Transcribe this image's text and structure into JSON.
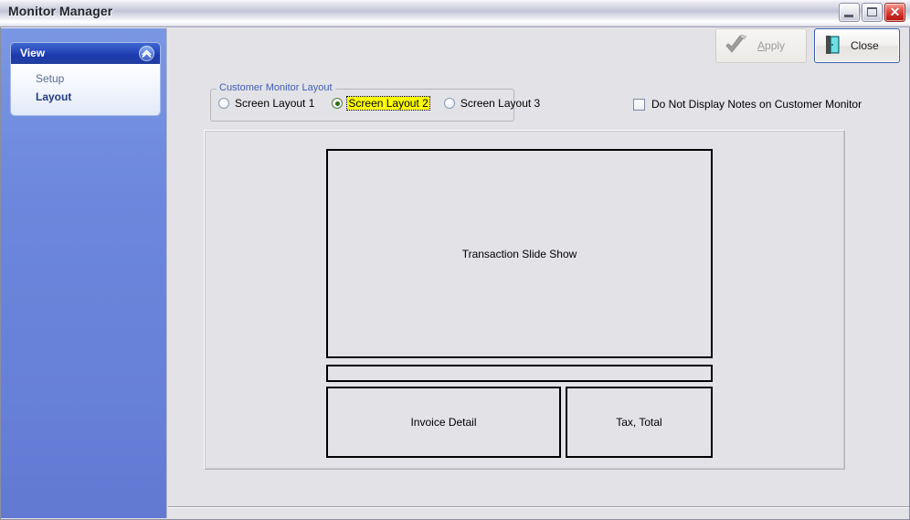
{
  "window": {
    "title": "Monitor Manager",
    "controls": [
      {
        "name": "minimize",
        "glyph": "minimize-icon"
      },
      {
        "name": "maximize",
        "glyph": "maximize-icon"
      },
      {
        "name": "close",
        "glyph": "close-icon",
        "label": "✕"
      }
    ],
    "titlebar_color": "#c2c4d6"
  },
  "sidebar": {
    "background_color": "#6b85db",
    "group": {
      "title": "View",
      "collapse_icon": "chevron-up-icon",
      "items": [
        {
          "label": "Setup",
          "active": false
        },
        {
          "label": "Layout",
          "active": true
        }
      ]
    }
  },
  "toolbar": {
    "apply": {
      "label": "Apply",
      "accel": "A",
      "enabled": false,
      "icon": "checkmark-icon"
    },
    "close": {
      "label": "Close",
      "enabled": true,
      "icon": "exit-door-icon"
    }
  },
  "groupbox": {
    "legend": "Customer Monitor Layout",
    "legend_color": "#3f5fb5",
    "options": [
      {
        "label": "Screen Layout 1",
        "checked": false,
        "focused": false
      },
      {
        "label": "Screen Layout 2",
        "checked": true,
        "focused": true
      },
      {
        "label": "Screen Layout 3",
        "checked": false,
        "focused": false
      }
    ],
    "highlight_color": "#ffff00"
  },
  "checkbox": {
    "label": "Do Not Display Notes on Customer Monitor",
    "checked": false
  },
  "preview": {
    "regions": [
      {
        "name": "slideshow",
        "label": "Transaction Slide Show"
      },
      {
        "name": "strip",
        "label": ""
      },
      {
        "name": "invoice",
        "label": "Invoice Detail"
      },
      {
        "name": "taxtotal",
        "label": "Tax, Total"
      }
    ]
  }
}
